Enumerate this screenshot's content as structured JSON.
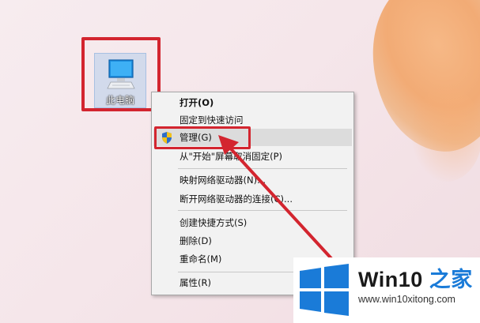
{
  "desktop": {
    "icon_label": "此电脑",
    "icon_name": "computer-icon"
  },
  "context_menu": {
    "items": [
      {
        "label": "打开(O)",
        "bold": true
      },
      {
        "label": "固定到快速访问"
      },
      {
        "label": "管理(G)",
        "highlighted": true,
        "icon": "uac-shield-icon"
      },
      {
        "label": "从\"开始\"屏幕取消固定(P)"
      },
      {
        "label": "映射网络驱动器(N)..."
      },
      {
        "label": "断开网络驱动器的连接(C)..."
      },
      {
        "label": "创建快捷方式(S)"
      },
      {
        "label": "删除(D)"
      },
      {
        "label": "重命名(M)"
      },
      {
        "label": "属性(R)"
      }
    ]
  },
  "annotations": {
    "highlight_color": "#d3252f"
  },
  "watermark": {
    "brand_part1": "Win10",
    "brand_part2": "之家",
    "url": "www.win10xitong.com",
    "logo_color": "#1a7bd8"
  }
}
